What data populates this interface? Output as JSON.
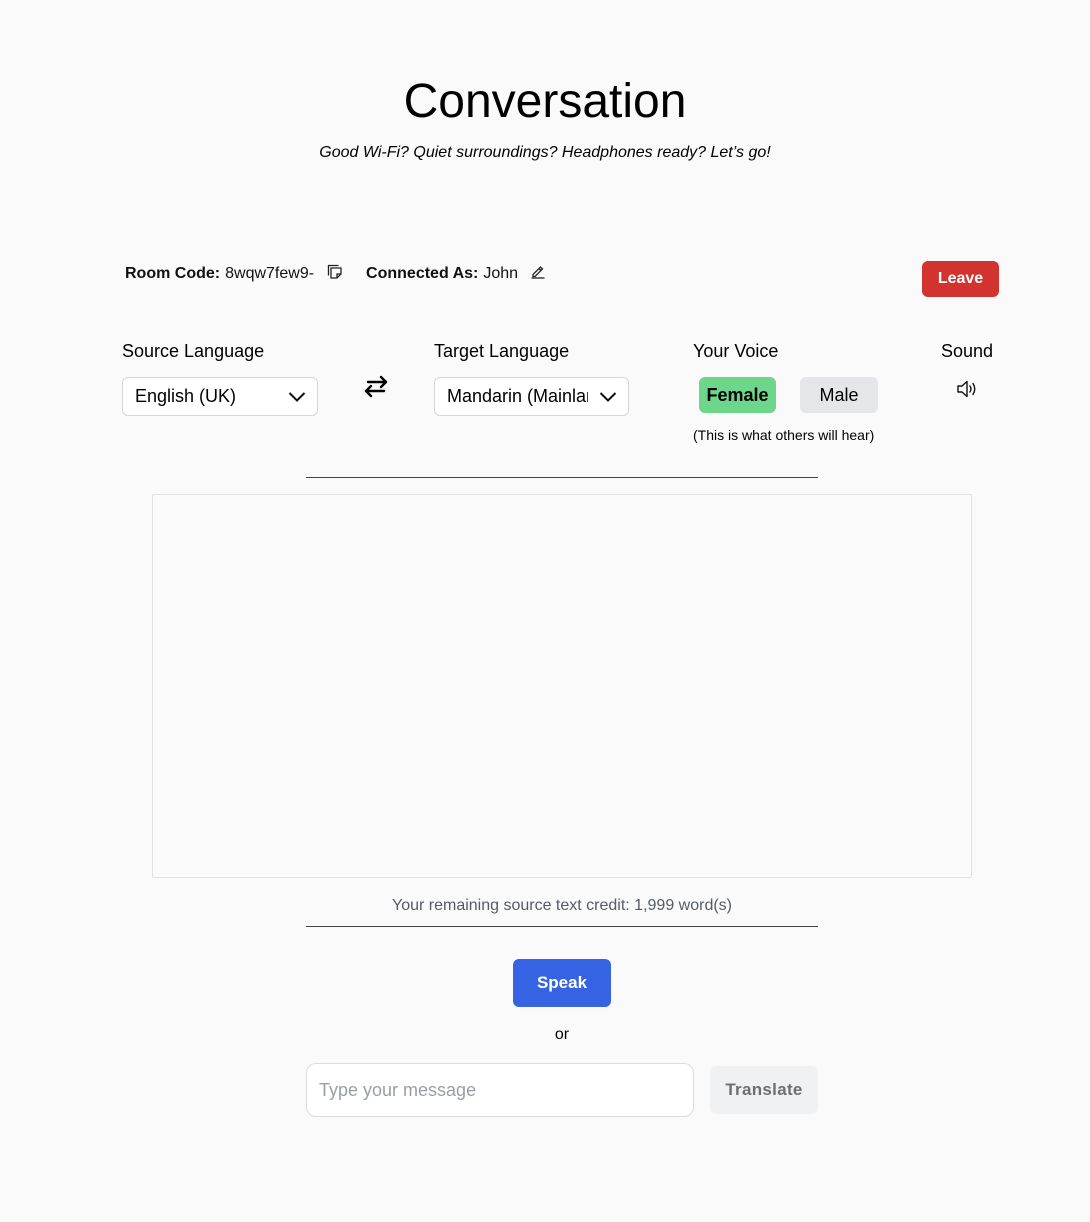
{
  "header": {
    "title": "Conversation",
    "subtitle": "Good Wi-Fi? Quiet surroundings? Headphones ready? Let’s go!"
  },
  "room": {
    "room_code_label": "Room Code:",
    "room_code_value": "8wqw7few9-",
    "copy_icon": "copy-icon",
    "connected_label": "Connected As:",
    "connected_value": "John",
    "edit_icon": "pencil-icon",
    "leave_label": "Leave"
  },
  "languages": {
    "source_label": "Source Language",
    "source_value": "English (UK)",
    "swap_icon": "swap-arrows-icon",
    "target_label": "Target Language",
    "target_value": "Mandarin (Mainland)"
  },
  "voice": {
    "label": "Your Voice",
    "options": [
      "Female",
      "Male"
    ],
    "selected": "Female",
    "note": "(This is what others will hear)"
  },
  "sound": {
    "label": "Sound",
    "icon": "speaker-icon"
  },
  "conversation": {
    "messages": [],
    "credit_text": "Your remaining source text credit: 1,999 word(s)"
  },
  "actions": {
    "speak_label": "Speak",
    "or_text": "or",
    "message_placeholder": "Type your message",
    "translate_label": "Translate"
  },
  "colors": {
    "leave": "#d3332f",
    "female_selected": "#6dd68a",
    "male": "#e5e6e9",
    "speak": "#3563e3",
    "translate": "#f0f1f3"
  }
}
